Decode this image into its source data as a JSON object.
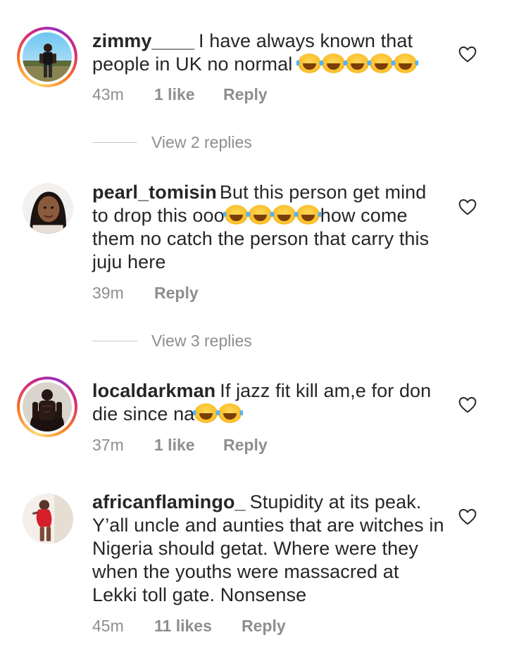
{
  "comments": [
    {
      "username": "zimmy____",
      "text": "I have always known that people in UK no normal",
      "emoji_after": [
        "😂",
        "😂",
        "😂",
        "😂",
        "😂"
      ],
      "time": "43m",
      "likes": "1 like",
      "reply_label": "Reply",
      "has_story_ring": true,
      "view_replies": "View 2 replies"
    },
    {
      "username": "pearl_tomisin",
      "text_before": "But this person get mind to drop this ooo",
      "emoji_mid": [
        "😂",
        "😂",
        "😂",
        "😂"
      ],
      "text_after": "how come them no catch the person that carry this juju here",
      "time": "39m",
      "reply_label": "Reply",
      "has_story_ring": false,
      "view_replies": "View 3 replies"
    },
    {
      "username": "localdarkman",
      "text": "If jazz fit kill am,e for don die since na",
      "emoji_after": [
        "😂",
        "😂"
      ],
      "time": "37m",
      "likes": "1 like",
      "reply_label": "Reply",
      "has_story_ring": true
    },
    {
      "username": "africanflamingo_",
      "text": "Stupidity at its peak. Y’all uncle and aunties that are witches in Nigeria should getat. Where were they when the youths were massacred at Lekki toll gate. Nonsense",
      "time": "45m",
      "likes": "11 likes",
      "reply_label": "Reply",
      "has_story_ring": false
    }
  ],
  "icons": {
    "like": "heart-outline-icon",
    "emoji": "face-with-tears-of-joy"
  },
  "colors": {
    "text": "#262626",
    "meta": "#8e8e8e",
    "story_ring_start": "#feda75",
    "story_ring_end": "#d62976"
  }
}
